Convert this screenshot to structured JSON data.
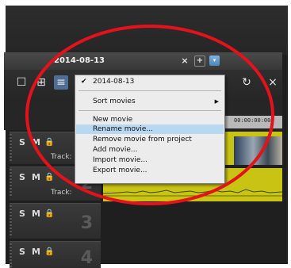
{
  "window": {
    "title": "2014-08-13",
    "close_glyph": "×",
    "plus_glyph": "+",
    "dropdown_glyph": "▾"
  },
  "toolbar": {
    "icons": [
      "single-view-icon",
      "grid-view-icon",
      "list-view-icon",
      "redo-icon",
      "close-icon"
    ],
    "glyphs": [
      "☐",
      "⊞",
      "≡",
      "↻",
      "×"
    ]
  },
  "ruler": {
    "time_label": "00:00:00:00"
  },
  "tracks": [
    {
      "s_label": "S",
      "m_label": "M",
      "lock_glyph": "🔒",
      "name": "Track:",
      "number": ""
    },
    {
      "s_label": "S",
      "m_label": "M",
      "lock_glyph": "🔒",
      "name": "Track:",
      "number": "2"
    },
    {
      "s_label": "S",
      "m_label": "M",
      "lock_glyph": "🔒",
      "name": "",
      "number": "3"
    },
    {
      "s_label": "S",
      "m_label": "M",
      "lock_glyph": "🔒",
      "name": "",
      "number": "4"
    }
  ],
  "menu": {
    "checked_item": "2014-08-13",
    "check_glyph": "✔",
    "submenu_label": "Sort movies",
    "submenu_arrow": "▶",
    "items": [
      "New movie",
      "Rename movie...",
      "Remove movie from project",
      "Add movie...",
      "Import movie...",
      "Export movie..."
    ],
    "highlighted_index": 1
  },
  "colors": {
    "annotation_ellipse": "#e3121b",
    "menu_highlight": "#b8d7f1",
    "clip_yellow": "#c9c414",
    "accent_blue": "#4f86b9"
  }
}
